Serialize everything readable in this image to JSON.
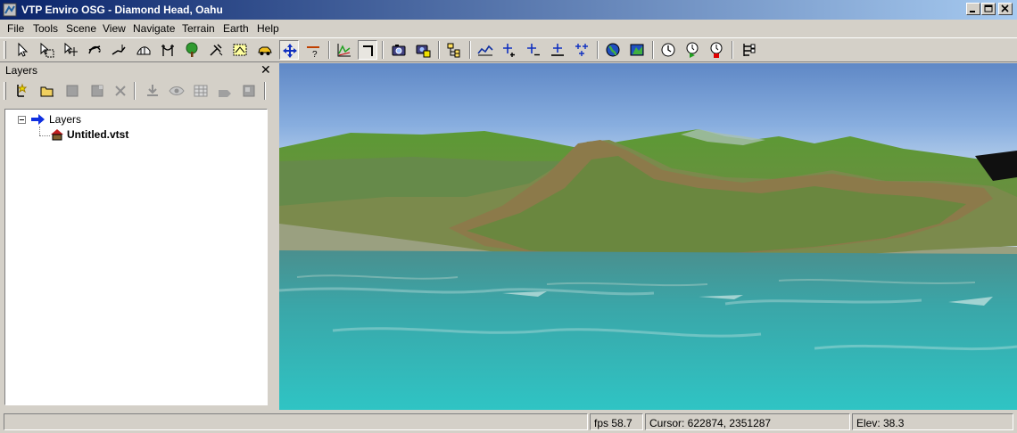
{
  "window": {
    "title": "VTP Enviro OSG - Diamond Head, Oahu"
  },
  "menu": [
    "File",
    "Tools",
    "Scene",
    "View",
    "Navigate",
    "Terrain",
    "Earth",
    "Help"
  ],
  "toolbar": {
    "buttons": [
      "select",
      "select-box",
      "select-move",
      "select-rotate",
      "select-height",
      "fence-tool",
      "route-tool",
      "plant-tool",
      "instance-tool",
      "building-tool",
      "vehicle-tool",
      "navigate-tool",
      "measure-tool",
      "culture-tool",
      "maintain-height",
      "snapshot",
      "snapshot-numbered",
      "terrain-manager",
      "flythrough",
      "nav-normal",
      "nav-velocity",
      "nav-grab-pivot",
      "nav-pano",
      "globe",
      "terrain-swap",
      "time",
      "time-faster",
      "time-stop",
      "scene-graph"
    ],
    "pressed": [
      "navigate-tool",
      "maintain-height"
    ]
  },
  "layers": {
    "panel_title": "Layers",
    "close_symbol": "✕",
    "tree": {
      "root": "Layers",
      "child": "Untitled.vtst"
    }
  },
  "statusbar": {
    "fps": "fps 58.7",
    "cursor": "Cursor:  622874, 2351287",
    "elev": "Elev: 38.3"
  },
  "colors": {
    "title_start": "#0a246a",
    "title_end": "#a6caf0",
    "face": "#d4d0c8",
    "sea": "#3fb5b4",
    "terrain": "#6c9a3a"
  }
}
